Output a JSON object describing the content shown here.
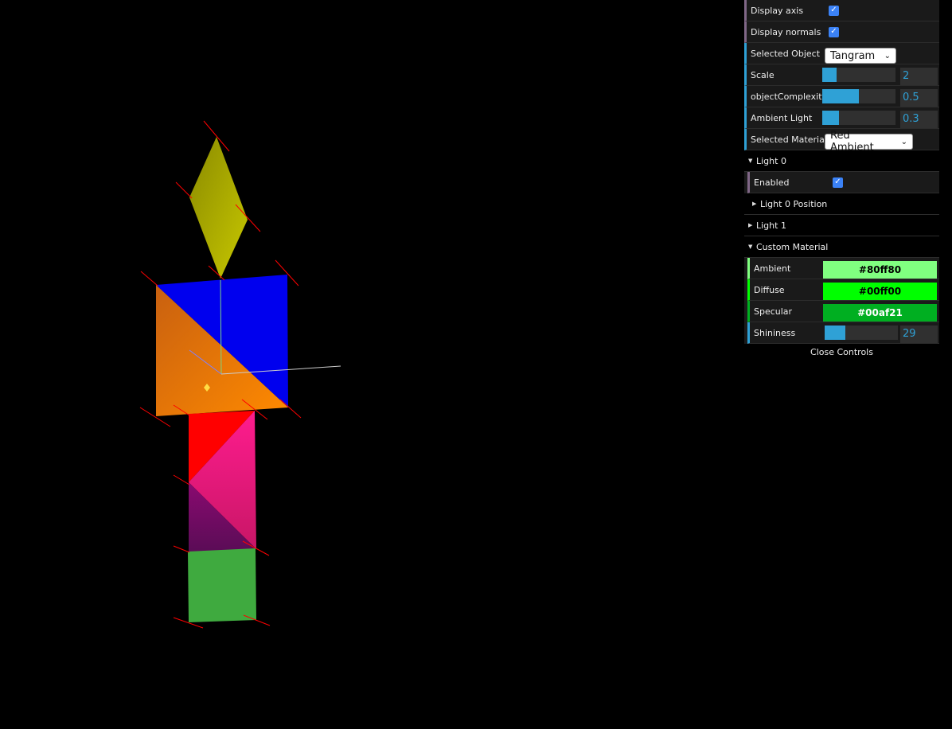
{
  "gui": {
    "display_axis": {
      "label": "Display axis",
      "checked": true
    },
    "display_normals": {
      "label": "Display normals",
      "checked": true
    },
    "selected_object": {
      "label": "Selected Object",
      "value": "Tangram"
    },
    "scale": {
      "label": "Scale",
      "value": "2",
      "fraction": 0.2
    },
    "object_complexity": {
      "label": "objectComplexity",
      "value": "0.5",
      "fraction": 0.5
    },
    "ambient_light": {
      "label": "Ambient Light",
      "value": "0.3",
      "fraction": 0.23
    },
    "selected_material": {
      "label": "Selected Material",
      "value": "Red Ambient"
    },
    "light0": {
      "title": "Light 0",
      "enabled": {
        "label": "Enabled",
        "checked": true
      },
      "position_folder": "Light 0 Position"
    },
    "light1": {
      "title": "Light 1"
    },
    "custom_material": {
      "title": "Custom Material",
      "ambient": {
        "label": "Ambient",
        "value": "#80ff80",
        "color": "#80ff80",
        "text_color": "#000000"
      },
      "diffuse": {
        "label": "Diffuse",
        "value": "#00ff00",
        "color": "#00ff00",
        "text_color": "#000000"
      },
      "specular": {
        "label": "Specular",
        "value": "#00af21",
        "color": "#00af21",
        "text_color": "#ffffff"
      },
      "shininess": {
        "label": "Shininess",
        "value": "29",
        "fraction": 0.28
      }
    },
    "close_label": "Close Controls"
  },
  "scene": {
    "background": "#000000",
    "pieces": [
      {
        "name": "yellow-parallelogram",
        "color": "#a8a800"
      },
      {
        "name": "blue-square-triangle",
        "color": "#0000f0"
      },
      {
        "name": "orange-triangle",
        "color": "#f07800"
      },
      {
        "name": "red-triangle",
        "color": "#ff0000"
      },
      {
        "name": "pink-triangle",
        "color": "#e0207a"
      },
      {
        "name": "purple-triangle",
        "color": "#7a1064"
      },
      {
        "name": "green-square",
        "color": "#3faa3f"
      }
    ],
    "normals_color": "#ff0000"
  }
}
